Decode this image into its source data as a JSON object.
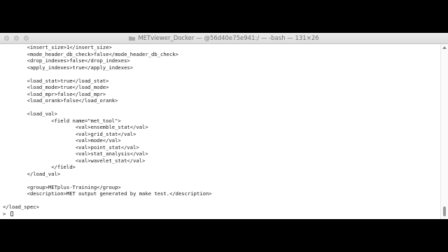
{
  "window": {
    "title": "METviewer_Docker — @56d40e75e941:/ — -bash — 131×26"
  },
  "icons": {
    "folder": "folder-icon",
    "close": "close-icon",
    "minimize": "minimize-icon",
    "maximize": "maximize-icon",
    "scroll_up": "chevron-up-icon"
  },
  "terminal": {
    "lines": [
      "        <insert_size>1</insert_size>",
      "        <mode_header_db_check>false</mode_header_db_check>",
      "        <drop_indexes>false</drop_indexes>",
      "        <apply_indexes>true</apply_indexes>",
      "",
      "        <load_stat>true</load_stat>",
      "        <load_mode>true</load_mode>",
      "        <load_mpr>false</load_mpr>",
      "        <load_orank>false</load_orank>",
      "",
      "        <load_val>",
      "                <field name=\"met_tool\">",
      "                        <val>ensemble_stat</val>",
      "                        <val>grid_stat</val>",
      "                        <val>mode</val>",
      "                        <val>point_stat</val>",
      "                        <val>stat_analysis</val>",
      "                        <val>wavelet_stat</val>",
      "                </field>",
      "        </load_val>",
      "",
      "        <group>METplus-Training</group>",
      "        <description>MET output generated by make test.</description>",
      "",
      "</load_spec>",
      "> "
    ]
  },
  "colors": {
    "background": "#000000",
    "terminal_bg": "#ffffff",
    "text": "#1a1a1a",
    "titlebar": "#e4e4e4"
  }
}
